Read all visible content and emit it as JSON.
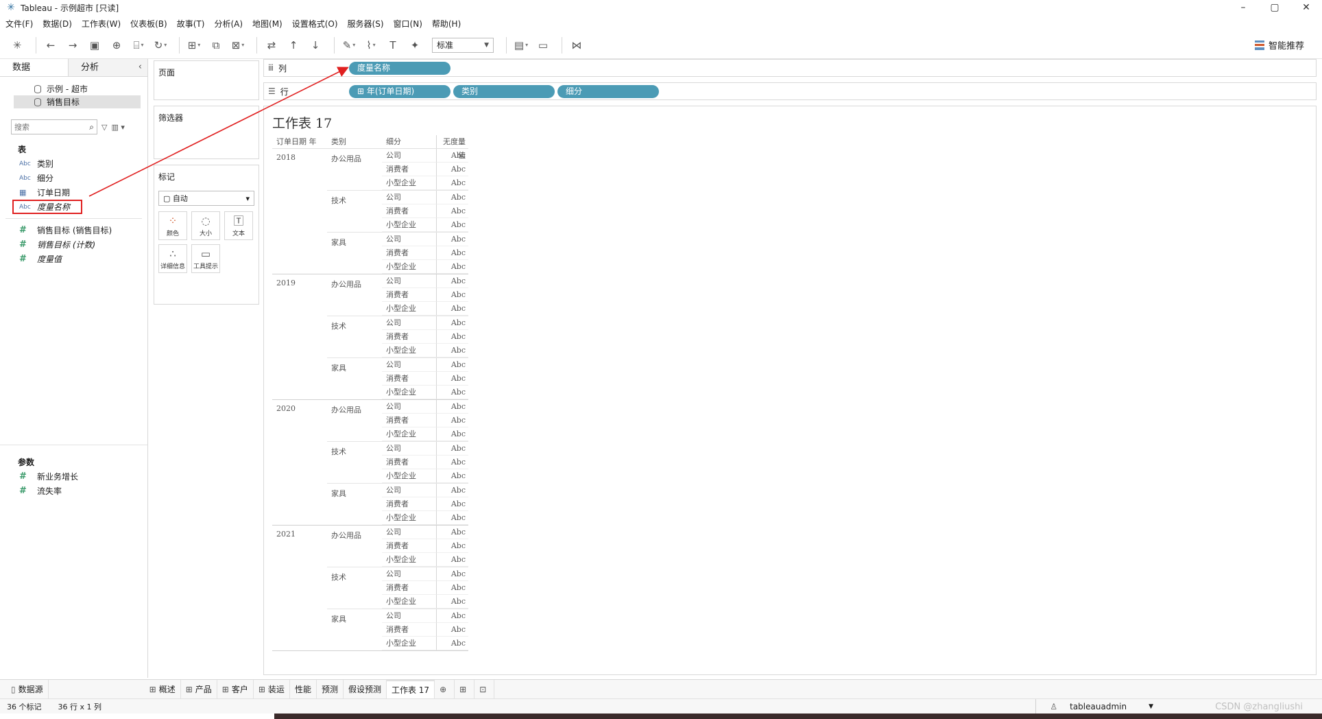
{
  "window": {
    "title": "Tableau - 示例超市 [只读]",
    "controls": [
      "–",
      "▢",
      "✕"
    ]
  },
  "menu": [
    "文件(F)",
    "数据(D)",
    "工作表(W)",
    "仪表板(B)",
    "故事(T)",
    "分析(A)",
    "地图(M)",
    "设置格式(O)",
    "服务器(S)",
    "窗口(N)",
    "帮助(H)"
  ],
  "toolbar": {
    "fit_value": "标准",
    "smart_label": "智能推荐"
  },
  "left_pane": {
    "tabs": [
      "数据",
      "分析"
    ],
    "datasources": [
      "示例 - 超市",
      "销售目标"
    ],
    "search_placeholder": "搜索",
    "tables_header": "表",
    "dimensions": [
      {
        "type": "Abc",
        "label": "类别"
      },
      {
        "type": "Abc",
        "label": "细分"
      },
      {
        "type": "date",
        "label": "订单日期"
      },
      {
        "type": "Abc",
        "label": "度量名称"
      }
    ],
    "measures": [
      {
        "label": "销售目标 (销售目标)"
      },
      {
        "label": "销售目标 (计数)"
      },
      {
        "label": "度量值"
      }
    ],
    "params_header": "参数",
    "params": [
      "新业务增长",
      "流失率"
    ]
  },
  "cards": {
    "pages": "页面",
    "filters": "筛选器",
    "marks": "标记",
    "mark_type": "自动",
    "mark_buttons": [
      "颜色",
      "大小",
      "文本",
      "详细信息",
      "工具提示"
    ]
  },
  "shelves": {
    "columns_label": "列",
    "rows_label": "行",
    "columns_pills": [
      "度量名称"
    ],
    "rows_pills": [
      "年(订单日期)",
      "类别",
      "细分"
    ]
  },
  "viz": {
    "title": "工作表 17",
    "headers": [
      "订单日期 年",
      "类别",
      "细分",
      "无度量值"
    ],
    "years": [
      "2018",
      "2019",
      "2020",
      "2021"
    ],
    "categories": [
      "办公用品",
      "技术",
      "家具"
    ],
    "segments": [
      "公司",
      "消费者",
      "小型企业"
    ],
    "cell_value": "Abc"
  },
  "sheet_tabs": [
    "数据源",
    "概述",
    "产品",
    "客户",
    "装运",
    "性能",
    "预测",
    "假设预测",
    "工作表 17"
  ],
  "status": {
    "marks": "36 个标记",
    "dims": "36 行 x 1 列",
    "user": "tableauadmin",
    "watermark": "CSDN @zhangliushi"
  }
}
